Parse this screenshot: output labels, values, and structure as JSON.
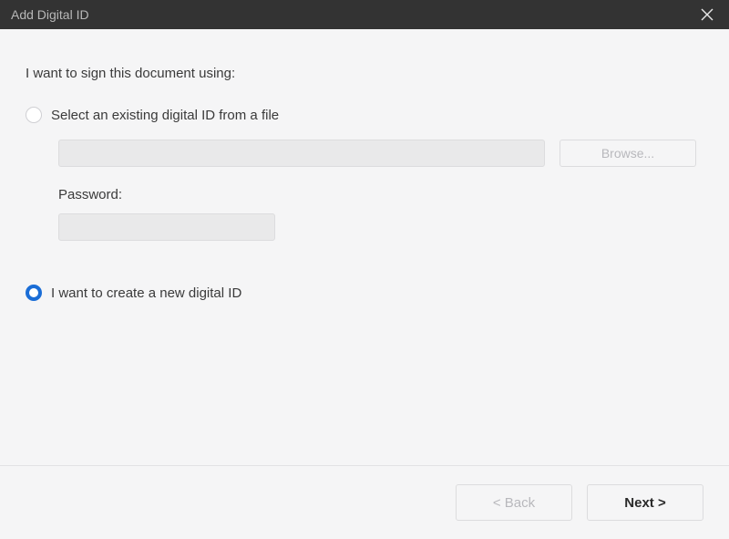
{
  "titlebar": {
    "title": "Add Digital ID"
  },
  "content": {
    "intro": "I want to sign this document using:",
    "option_existing": {
      "label": "Select an existing digital ID from a file",
      "selected": false,
      "file_value": "",
      "browse_label": "Browse...",
      "password_label": "Password:",
      "password_value": ""
    },
    "option_new": {
      "label": "I want to create a new digital ID",
      "selected": true
    }
  },
  "footer": {
    "back_label": "< Back",
    "next_label": "Next >"
  }
}
